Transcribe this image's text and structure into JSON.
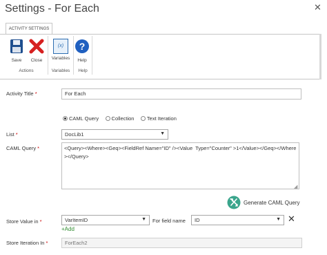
{
  "window": {
    "title": "Settings - For Each"
  },
  "ribbon": {
    "tab_label": "ACTIVITY SETTINGS",
    "buttons": {
      "save": "Save",
      "close": "Close",
      "variables": "Variables",
      "help": "Help"
    },
    "groups": {
      "actions": "Actions",
      "variables": "Variables",
      "help": "Help"
    },
    "variables_icon_text": "(x)"
  },
  "form": {
    "activity_title": {
      "label": "Activity Title",
      "required": "*",
      "value": "For Each"
    },
    "source_options": [
      "CAML Query",
      "Collection",
      "Text Iteration"
    ],
    "list": {
      "label": "List",
      "required": "*",
      "value": "DocLib1"
    },
    "caml_query": {
      "label": "CAML Query",
      "required": "*",
      "value": "<Query><Where><Geq><FieldRef Name=\"ID\" /><Value  Type=\"Counter\" >1</Value></Geq></Where></Query>"
    },
    "generate_button": "Generate CAML Query",
    "store_value": {
      "label": "Store Value in",
      "required": "*",
      "value": "VarItemID",
      "field_label": "For field name",
      "field_value": "ID",
      "add_label": "Add",
      "add_symbol": "+"
    },
    "store_iteration": {
      "label": "Store Iteration In",
      "required": "*",
      "placeholder": "ForEach2"
    }
  }
}
